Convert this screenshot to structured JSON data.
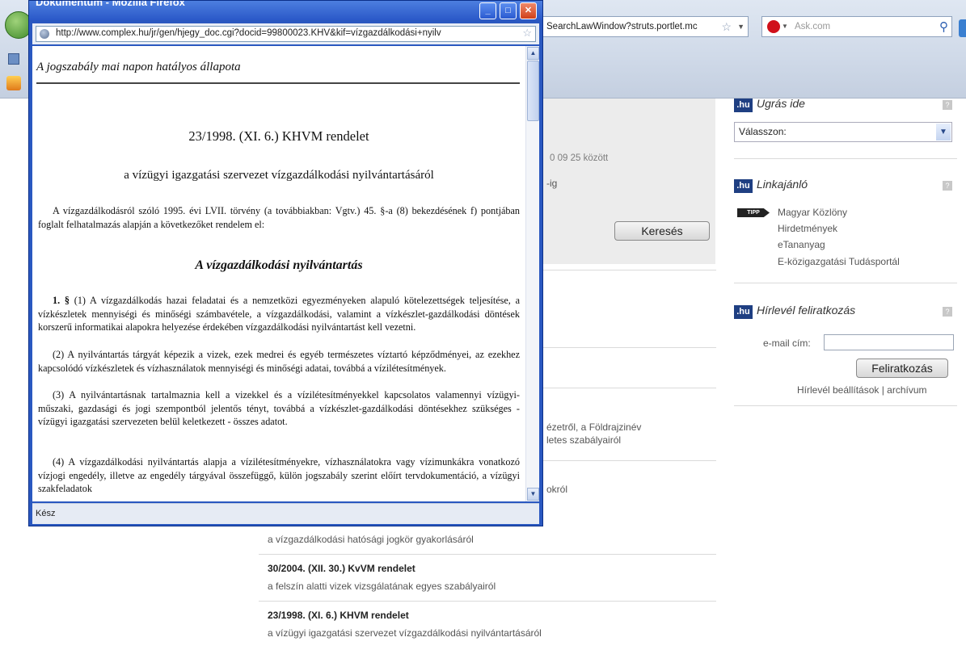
{
  "background_browser": {
    "url": "SearchLawWindow?struts.portlet.mc",
    "search_placeholder": "Ask.com"
  },
  "background_page": {
    "date_range_text": "0 09 25 között",
    "date_suffix": "-ig",
    "search_button": "Keresés",
    "partial_lines": [
      "ézetről, a Földrajzinév",
      "letes szabályairól",
      "okról"
    ],
    "results": [
      {
        "title": "",
        "description": "a vízgazdálkodási hatósági jogkör gyakorlásáról"
      },
      {
        "title": "30/2004. (XII. 30.) KvVM rendelet",
        "description": "a felszín alatti vizek vizsgálatának egyes szabályairól"
      },
      {
        "title": "23/1998. (XI. 6.) KHVM rendelet",
        "description": "a vízügyi igazgatási szervezet vízgazdálkodási nyilvántartásáról"
      }
    ]
  },
  "sidebar": {
    "badge": ".hu",
    "jump": {
      "title": "Ugrás ide",
      "select_value": "Válasszon:"
    },
    "links": {
      "title": "Linkajánló",
      "tipp": "TIPP",
      "items": [
        "Magyar Közlöny",
        "Hirdetmények",
        "eTananyag",
        "E-közigazgatási Tudásportál"
      ]
    },
    "newsletter": {
      "title": "Hírlevél feliratkozás",
      "email_label": "e-mail cím:",
      "email_value": "",
      "subscribe_button": "Feliratkozás",
      "settings_text": "Hírlevél beállítások | archívum"
    }
  },
  "popup": {
    "window_title": "Dokumentum - Mozilla Firefox",
    "url": "http://www.complex.hu/jr/gen/hjegy_doc.cgi?docid=99800023.KHV&kif=vízgazdálkodási+nyilv",
    "status": "Kész",
    "document": {
      "status_line": "A jogszabály mai napon hatályos állapota",
      "title": "23/1998. (XI. 6.) KHVM rendelet",
      "subtitle": "a vízügyi igazgatási szervezet vízgazdálkodási nyilvántartásáról",
      "preamble": "A vízgazdálkodásról szóló 1995. évi LVII. törvény (a továbbiakban: Vgtv.) 45. §-a (8) bekezdésének f) pontjában foglalt felhatalmazás alapján a következőket rendelem el:",
      "section_heading": "A vízgazdálkodási nyilvántartás",
      "p1_lead": "1. §",
      "p1": "(1) A vízgazdálkodás hazai feladatai és a nemzetközi egyezményeken alapuló kötelezettségek teljesítése, a vízkészletek mennyiségi és minőségi számbavétele, a vízgazdálkodási, valamint a vízkészlet-gazdálkodási döntések korszerű informatikai alapokra helyezése érdekében vízgazdálkodási nyilvántartást kell vezetni.",
      "p2": "(2) A nyilvántartás tárgyát képezik a vizek, ezek medrei és egyéb természetes víztartó képződményei, az ezekhez kapcsolódó vízkészletek és vízhasználatok mennyiségi és minőségi adatai, továbbá a vízilétesítmények.",
      "p3": "(3) A nyilvántartásnak tartalmaznia kell a vizekkel és a vízilétesítményekkel kapcsolatos valamennyi vízügyi-műszaki, gazdasági és jogi szempontból jelentős tényt, továbbá a vízkészlet-gazdálkodási döntésekhez szükséges - vízügyi igazgatási szervezeten belül keletkezett - összes adatot.",
      "p4": "(4) A vízgazdálkodási nyilvántartás alapja a vízilétesítményekre, vízhasználatokra vagy vízimunkákra vonatkozó vízjogi engedély, illetve az engedély tárgyával összefüggő, külön jogszabály szerint előírt tervdokumentáció, a vízügyi szakfeladatok"
    }
  }
}
